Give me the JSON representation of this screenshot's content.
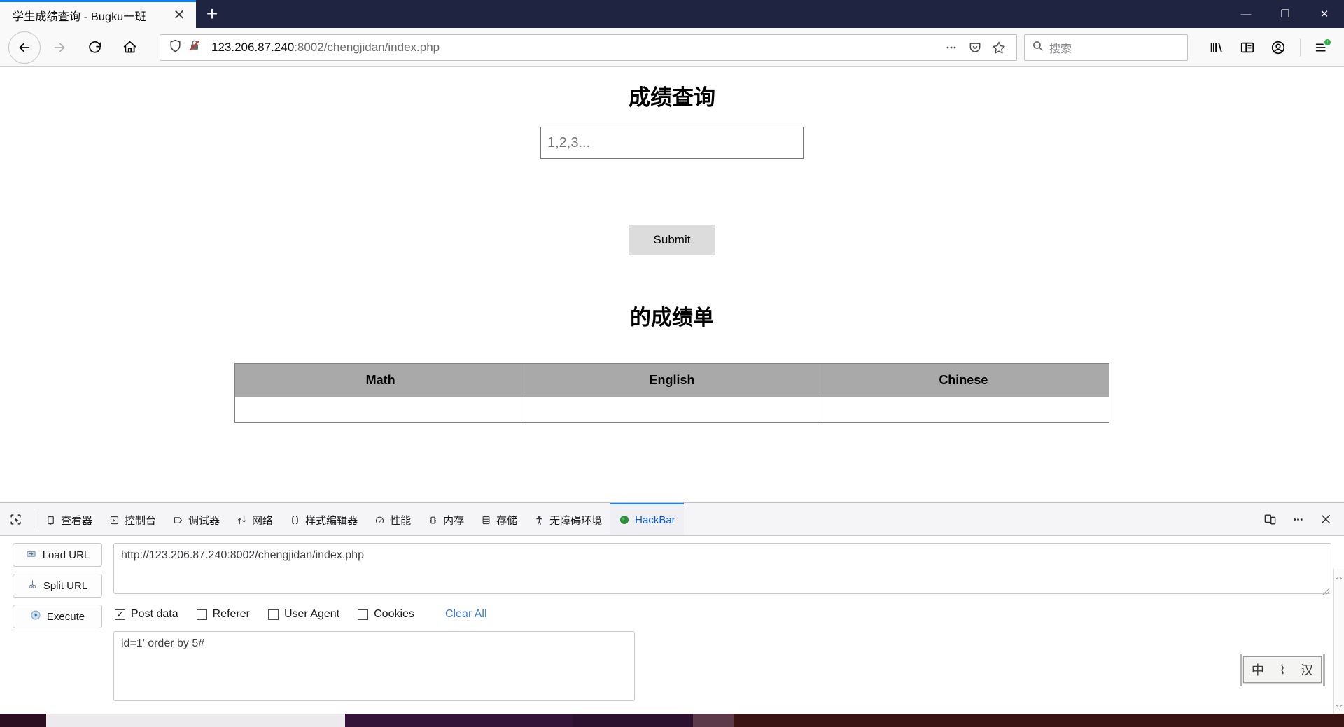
{
  "browser": {
    "tab": {
      "title": "学生成绩查询 - Bugku一班",
      "close_label": "✕"
    },
    "new_tab_label": "+",
    "window_controls": {
      "minimize": "—",
      "maximize": "❐",
      "close": "✕"
    },
    "nav": {
      "back_icon": "back-arrow-icon",
      "forward_icon": "forward-arrow-icon",
      "reload_icon": "reload-icon",
      "home_icon": "home-icon"
    },
    "url": {
      "host": "123.206.87.240",
      "path": ":8002/chengjidan/index.php",
      "full": "123.206.87.240:8002/chengjidan/index.php",
      "shield_icon": "shield-icon",
      "insecure_icon": "insecure-lock-icon",
      "page_actions_icon": "ellipsis-icon",
      "pocket_icon": "pocket-icon",
      "bookmark_icon": "star-icon"
    },
    "search": {
      "placeholder": "搜索",
      "icon": "search-icon"
    },
    "toolbar_right": {
      "library_icon": "library-icon",
      "sidebar_icon": "sidebar-icon",
      "account_icon": "account-icon",
      "menu_icon": "hamburger-menu-icon",
      "update_badge": "↑"
    }
  },
  "page": {
    "title": "成绩查询",
    "input_placeholder": "1,2,3...",
    "input_value": "",
    "submit_label": "Submit",
    "result_title": "的成绩单",
    "table": {
      "headers": [
        "Math",
        "English",
        "Chinese"
      ],
      "rows": [
        [
          "",
          "",
          ""
        ]
      ]
    }
  },
  "devtools": {
    "picker_icon": "element-picker-icon",
    "tabs": [
      {
        "label": "查看器",
        "icon": "inspector-icon",
        "active": false
      },
      {
        "label": "控制台",
        "icon": "console-icon",
        "active": false
      },
      {
        "label": "调试器",
        "icon": "debugger-icon",
        "active": false
      },
      {
        "label": "网络",
        "icon": "network-icon",
        "active": false
      },
      {
        "label": "样式编辑器",
        "icon": "style-editor-icon",
        "active": false
      },
      {
        "label": "性能",
        "icon": "performance-icon",
        "active": false
      },
      {
        "label": "内存",
        "icon": "memory-icon",
        "active": false
      },
      {
        "label": "存储",
        "icon": "storage-icon",
        "active": false
      },
      {
        "label": "无障碍环境",
        "icon": "accessibility-icon",
        "active": false
      },
      {
        "label": "HackBar",
        "icon": "hackbar-icon",
        "active": true
      }
    ],
    "right_buttons": {
      "responsive_icon": "responsive-design-mode-icon",
      "meatball_icon": "ellipsis-icon",
      "close_icon": "close-icon"
    },
    "scroll_up": "︿",
    "scroll_down": "﹀"
  },
  "hackbar": {
    "buttons": [
      {
        "label": "Load URL",
        "icon": "load-url-icon"
      },
      {
        "label": "Split URL",
        "icon": "split-url-scissors-icon"
      },
      {
        "label": "Execute",
        "icon": "execute-play-icon"
      }
    ],
    "url_value": "http://123.206.87.240:8002/chengjidan/index.php",
    "options": [
      {
        "label": "Post data",
        "checked": true
      },
      {
        "label": "Referer",
        "checked": false
      },
      {
        "label": "User Agent",
        "checked": false
      },
      {
        "label": "Cookies",
        "checked": false
      }
    ],
    "checked_mark": "✓",
    "clear_all_label": "Clear All",
    "post_data_value": "id=1' order by 5#"
  },
  "ime": {
    "mode": "中",
    "glyph2": "⌇",
    "glyph3": "汉"
  },
  "colors": {
    "titlebar_bg": "#1f2440",
    "accent_blue": "#0a84ff",
    "link_blue": "#3b79d4",
    "table_header_bg": "#a9a9a9",
    "taskbar_bg": "#2a1020"
  }
}
